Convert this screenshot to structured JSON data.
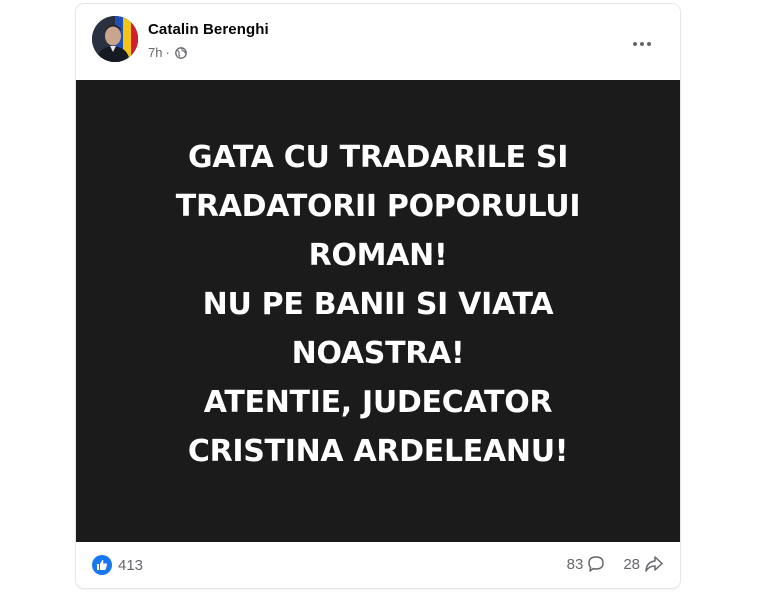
{
  "post": {
    "author": "Catalin Berenghi",
    "time": "7h",
    "separator": "·",
    "privacy_icon": "globe-icon",
    "more_icon": "more-options-icon",
    "image_text_lines": [
      "GATA CU TRADARILE SI",
      "TRADATORII POPORULUI",
      "ROMAN!",
      "NU PE BANII SI VIATA",
      "NOASTRA!",
      "ATENTIE, JUDECATOR",
      "CRISTINA ARDELEANU!"
    ],
    "image_background": "#1b1b1b",
    "reactions_count": "413",
    "comments_count": "83",
    "shares_count": "28",
    "like_color": "#1877f2"
  }
}
